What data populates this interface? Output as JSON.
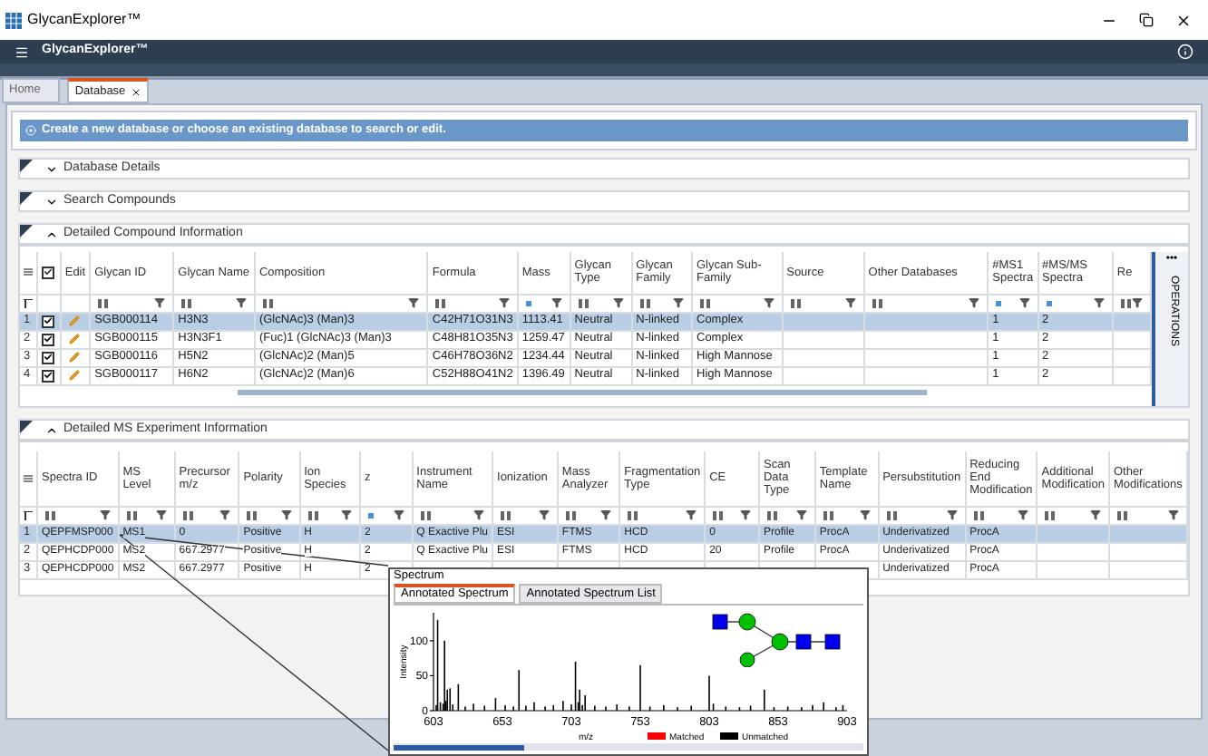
{
  "window": {
    "title": "GlycanExplorer™"
  },
  "app_header": {
    "title": "GlycanExplorer™"
  },
  "tabs": [
    {
      "label": "Home",
      "selected": false,
      "closable": false
    },
    {
      "label": "Database",
      "selected": true,
      "closable": true
    }
  ],
  "banner": "Create a new database or choose an existing database to search or edit.",
  "sections": [
    {
      "title": "Database Details",
      "expanded": false
    },
    {
      "title": "Search Compounds",
      "expanded": false
    }
  ],
  "compounds": {
    "title": "Detailed Compound Information",
    "expanded": true,
    "all_checked": true,
    "edit_label": "Edit",
    "side_panel": {
      "menu": "•••",
      "label": "OPERATIONS"
    },
    "columns": [
      {
        "label": "Glycan ID",
        "kind": "text"
      },
      {
        "label": "Glycan Name",
        "kind": "text"
      },
      {
        "label": "Composition",
        "kind": "text"
      },
      {
        "label": "Formula",
        "kind": "text"
      },
      {
        "label": "Mass",
        "kind": "number"
      },
      {
        "label": "Glycan Type",
        "kind": "text"
      },
      {
        "label": "Glycan Family",
        "kind": "text"
      },
      {
        "label": "Glycan Sub-Family",
        "kind": "text"
      },
      {
        "label": "Source",
        "kind": "text"
      },
      {
        "label": "Other Databases",
        "kind": "text"
      },
      {
        "label": "#MS1 Spectra",
        "kind": "number"
      },
      {
        "label": "#MS/MS Spectra",
        "kind": "number"
      },
      {
        "label": "Re",
        "kind": "text"
      }
    ],
    "rows": [
      {
        "num": "1",
        "selected": true,
        "checked": true,
        "cells": [
          "SGB000114",
          "H3N3",
          "(GlcNAc)3 (Man)3",
          "C42H71O31N3",
          "1113.41",
          "Neutral",
          "N-linked",
          "Complex",
          "",
          "",
          "1",
          "2",
          ""
        ]
      },
      {
        "num": "2",
        "selected": false,
        "checked": true,
        "cells": [
          "SGB000115",
          "H3N3F1",
          "(Fuc)1 (GlcNAc)3 (Man)3",
          "C48H81O35N3",
          "1259.47",
          "Neutral",
          "N-linked",
          "Complex",
          "",
          "",
          "1",
          "2",
          ""
        ]
      },
      {
        "num": "3",
        "selected": false,
        "checked": true,
        "cells": [
          "SGB000116",
          "H5N2",
          "(GlcNAc)2 (Man)5",
          "C46H78O36N2",
          "1234.44",
          "Neutral",
          "N-linked",
          "High Mannose",
          "",
          "",
          "1",
          "2",
          ""
        ]
      },
      {
        "num": "4",
        "selected": false,
        "checked": true,
        "cells": [
          "SGB000117",
          "H6N2",
          "(GlcNAc)2 (Man)6",
          "C52H88O41N2",
          "1396.49",
          "Neutral",
          "N-linked",
          "High Mannose",
          "",
          "",
          "1",
          "2",
          ""
        ]
      }
    ]
  },
  "experiments": {
    "title": "Detailed MS Experiment Information",
    "expanded": true,
    "columns": [
      {
        "label": "Spectra ID",
        "kind": "text"
      },
      {
        "label": "MS Level",
        "kind": "text"
      },
      {
        "label": "Precursor m/z",
        "kind": "text"
      },
      {
        "label": "Polarity",
        "kind": "text"
      },
      {
        "label": "Ion Species",
        "kind": "text"
      },
      {
        "label": "z",
        "kind": "number"
      },
      {
        "label": "Instrument Name",
        "kind": "text"
      },
      {
        "label": "Ionization",
        "kind": "text"
      },
      {
        "label": "Mass Analyzer",
        "kind": "text"
      },
      {
        "label": "Fragmentation Type",
        "kind": "text"
      },
      {
        "label": "CE",
        "kind": "text"
      },
      {
        "label": "Scan Data Type",
        "kind": "text"
      },
      {
        "label": "Template Name",
        "kind": "text"
      },
      {
        "label": "Persubstitution",
        "kind": "text"
      },
      {
        "label": "Reducing End Modification",
        "kind": "text"
      },
      {
        "label": "Additional Modification",
        "kind": "text"
      },
      {
        "label": "Other Modifications",
        "kind": "text"
      }
    ],
    "rows": [
      {
        "num": "1",
        "selected": true,
        "cells": [
          "QEPFMSP000",
          "MS1",
          "0",
          "Positive",
          "H",
          "2",
          "Q Exactive Plu",
          "ESI",
          "FTMS",
          "HCD",
          "0",
          "Profile",
          "ProcA",
          "Underivatized",
          "ProcA",
          "",
          ""
        ]
      },
      {
        "num": "2",
        "selected": false,
        "cells": [
          "QEPHCDP000",
          "MS2",
          "667.2977",
          "Positive",
          "H",
          "2",
          "Q Exactive Plu",
          "ESI",
          "FTMS",
          "HCD",
          "20",
          "Profile",
          "ProcA",
          "Underivatized",
          "ProcA",
          "",
          ""
        ]
      },
      {
        "num": "3",
        "selected": false,
        "cells": [
          "QEPHCDP000",
          "MS2",
          "667.2977",
          "Positive",
          "H",
          "2",
          "",
          "",
          "",
          "",
          "",
          "",
          "",
          "Underivatized",
          "ProcA",
          "",
          ""
        ]
      }
    ]
  },
  "spectrum_popup": {
    "title": "Spectrum",
    "legend": [
      {
        "name": "Matched",
        "color": "#ff0000"
      },
      {
        "name": "Unmatched",
        "color": "#000000"
      }
    ],
    "tabs": [
      {
        "label": "Annotated Spectrum",
        "selected": true
      },
      {
        "label": "Annotated Spectrum List",
        "selected": false
      }
    ],
    "chart_data": {
      "type": "bar",
      "xlabel": "m/z",
      "ylabel": "Intensity",
      "xlim": [
        603,
        903
      ],
      "ylim": [
        0,
        140
      ],
      "xticks": [
        603,
        653,
        703,
        753,
        803,
        853,
        903
      ],
      "yticks": [
        0,
        50,
        100
      ],
      "x": [
        605,
        606,
        608,
        610,
        611,
        612,
        613,
        615,
        617,
        621,
        626,
        632,
        640,
        648,
        655,
        661,
        665,
        670,
        676,
        684,
        690,
        697,
        703,
        706,
        708,
        709,
        711,
        713,
        720,
        728,
        736,
        745,
        753,
        760,
        770,
        780,
        790,
        803,
        806,
        815,
        825,
        833,
        843,
        850,
        860,
        870,
        878,
        886,
        895,
        900
      ],
      "series": [
        {
          "color": "#000000",
          "values": [
            8,
            130,
            12,
            10,
            100,
            14,
            30,
            32,
            9,
            38,
            6,
            10,
            7,
            18,
            8,
            6,
            58,
            7,
            12,
            6,
            8,
            14,
            9,
            70,
            12,
            30,
            8,
            22,
            7,
            6,
            9,
            6,
            65,
            6,
            8,
            5,
            7,
            50,
            10,
            6,
            5,
            7,
            30,
            5,
            6,
            5,
            8,
            12,
            5,
            8
          ]
        }
      ]
    }
  }
}
